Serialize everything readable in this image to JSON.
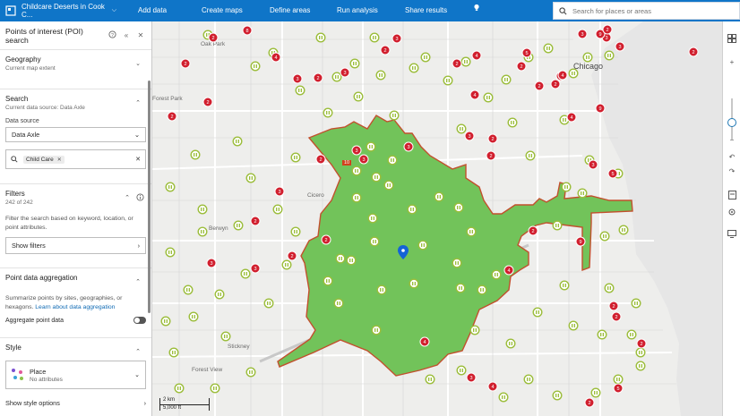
{
  "topbar": {
    "project_title": "Childcare Deserts in Cook C...",
    "nav": [
      "Add data",
      "Create maps",
      "Define areas",
      "Run analysis",
      "Share results"
    ],
    "search_placeholder": "Search for places or areas",
    "bg_color": "#0f75c8"
  },
  "panel": {
    "title": "Points of interest (POI) search",
    "geography": {
      "title": "Geography",
      "subtitle": "Current map extent"
    },
    "search": {
      "title": "Search",
      "subtitle": "Current data source: Data Axle",
      "data_source_label": "Data source",
      "data_source_value": "Data Axle",
      "chip_label": "Child Care"
    },
    "filters": {
      "title": "Filters",
      "count": "242 of 242",
      "description": "Filter the search based on keyword, location, or point attributes.",
      "show_button": "Show filters"
    },
    "aggregation": {
      "title": "Point data aggregation",
      "description": "Summarize points by sites, geographies, or hexagons.",
      "link": "Learn about data aggregation",
      "toggle_label": "Aggregate point data"
    },
    "style": {
      "title": "Style",
      "card_title": "Place",
      "card_subtitle": "No attributes",
      "show_options": "Show style options"
    }
  },
  "map": {
    "labels": [
      {
        "text": "Oak Park"
      },
      {
        "text": "Forest Park"
      },
      {
        "text": "Cicero"
      },
      {
        "text": "Berwyn"
      },
      {
        "text": "Stickney"
      },
      {
        "text": "Forest View"
      },
      {
        "text": "Chicago"
      }
    ],
    "highlight_label": "10",
    "scale": {
      "km": "2 km",
      "ft": "5,000 ft"
    },
    "colors": {
      "area_fill": "#72c35a",
      "area_stroke": "#c2502d",
      "cluster": "#d11f2e",
      "poi": "#9bbd3a",
      "pin": "#1463d6"
    }
  },
  "toolbar": {
    "icons": [
      "basemap-gallery-icon",
      "zoom-in-icon",
      "zoom-out-icon",
      "undo-icon",
      "redo-icon",
      "print-icon",
      "locate-icon",
      "screen-icon"
    ]
  }
}
